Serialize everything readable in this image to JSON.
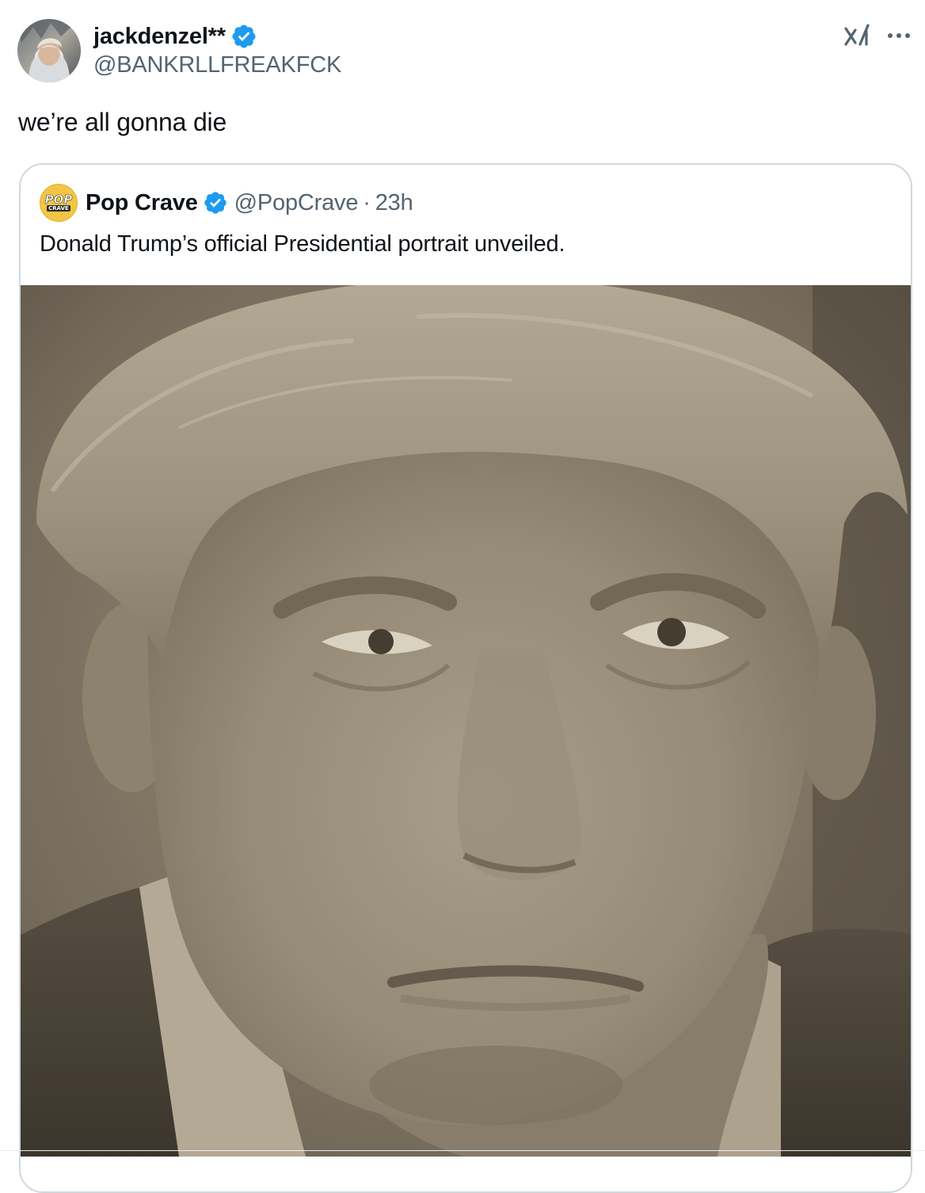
{
  "author": {
    "display_name": "jackdenzel**",
    "handle": "@BANKRLLFREAKFCK",
    "verified": true
  },
  "header_actions": {
    "grok_icon": "grok-icon",
    "more_icon": "more-icon"
  },
  "tweet": {
    "text": "we’re all gonna die"
  },
  "quoted_tweet": {
    "avatar_text_top": "POP",
    "avatar_text_bottom": "CRAVE",
    "display_name": "Pop Crave",
    "verified": true,
    "handle": "@PopCrave",
    "separator": "·",
    "time": "23h",
    "text": "Donald Trump’s official Presidential portrait unveiled.",
    "media_type": "photo"
  },
  "colors": {
    "verified_blue": "#1d9bf0",
    "secondary_text": "#536471",
    "border": "#cfd9de",
    "sepia_base": "#8f8373"
  }
}
